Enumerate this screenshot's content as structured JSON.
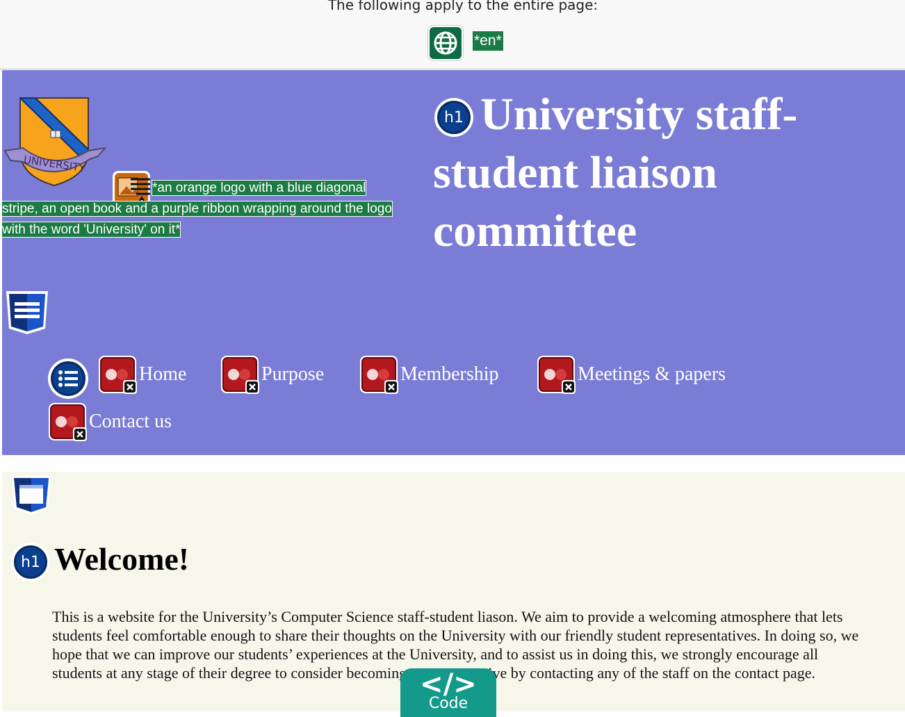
{
  "topbar": {
    "notice": "The following apply to the entire page:",
    "language_badge": "*en*"
  },
  "header": {
    "image_alt_text": "*an orange logo with a blue diagonal stripe, an open book and a purple ribbon wrapping around the logo with the word 'University' on it*",
    "logo_ribbon_text": "UNIVERSITY",
    "heading_badge": "h1",
    "site_title": "University staff-student liaison committee",
    "nav": {
      "items": [
        {
          "label": "Home"
        },
        {
          "label": "Purpose"
        },
        {
          "label": "Membership"
        },
        {
          "label": "Meetings & papers"
        },
        {
          "label": "Contact us"
        }
      ]
    }
  },
  "main": {
    "heading_badge": "h1",
    "heading": "Welcome!",
    "intro": "This is a website for the University’s Computer Science staff-student liason. We aim to provide a welcoming atmosphere that lets students feel comfortable enough to share their thoughts on the University with our friendly student representatives. In doing so, we hope that we can improve our students’ experiences at the University, and to assist us in doing this, we strongly encourage all students at any stage of their degree to consider becoming a representative by contacting any of the staff on the contact page."
  },
  "code_button": {
    "glyph": "</>",
    "label": "Code"
  },
  "colors": {
    "header_bg": "#7b7cd5",
    "main_bg": "#f7f6eb",
    "badge_green": "#1c7a44",
    "heading_icon_blue": "#0b3f8f",
    "link_icon_red": "#b3181f",
    "code_button": "#139a8b"
  },
  "icons": {
    "language": "globe-icon",
    "image_warning": "image-alt-warning-icon",
    "heading": "h1-icon",
    "list": "list-icon",
    "link": "broken-link-icon",
    "landmark_nav": "navigation-landmark-icon",
    "landmark_main": "main-landmark-icon"
  }
}
